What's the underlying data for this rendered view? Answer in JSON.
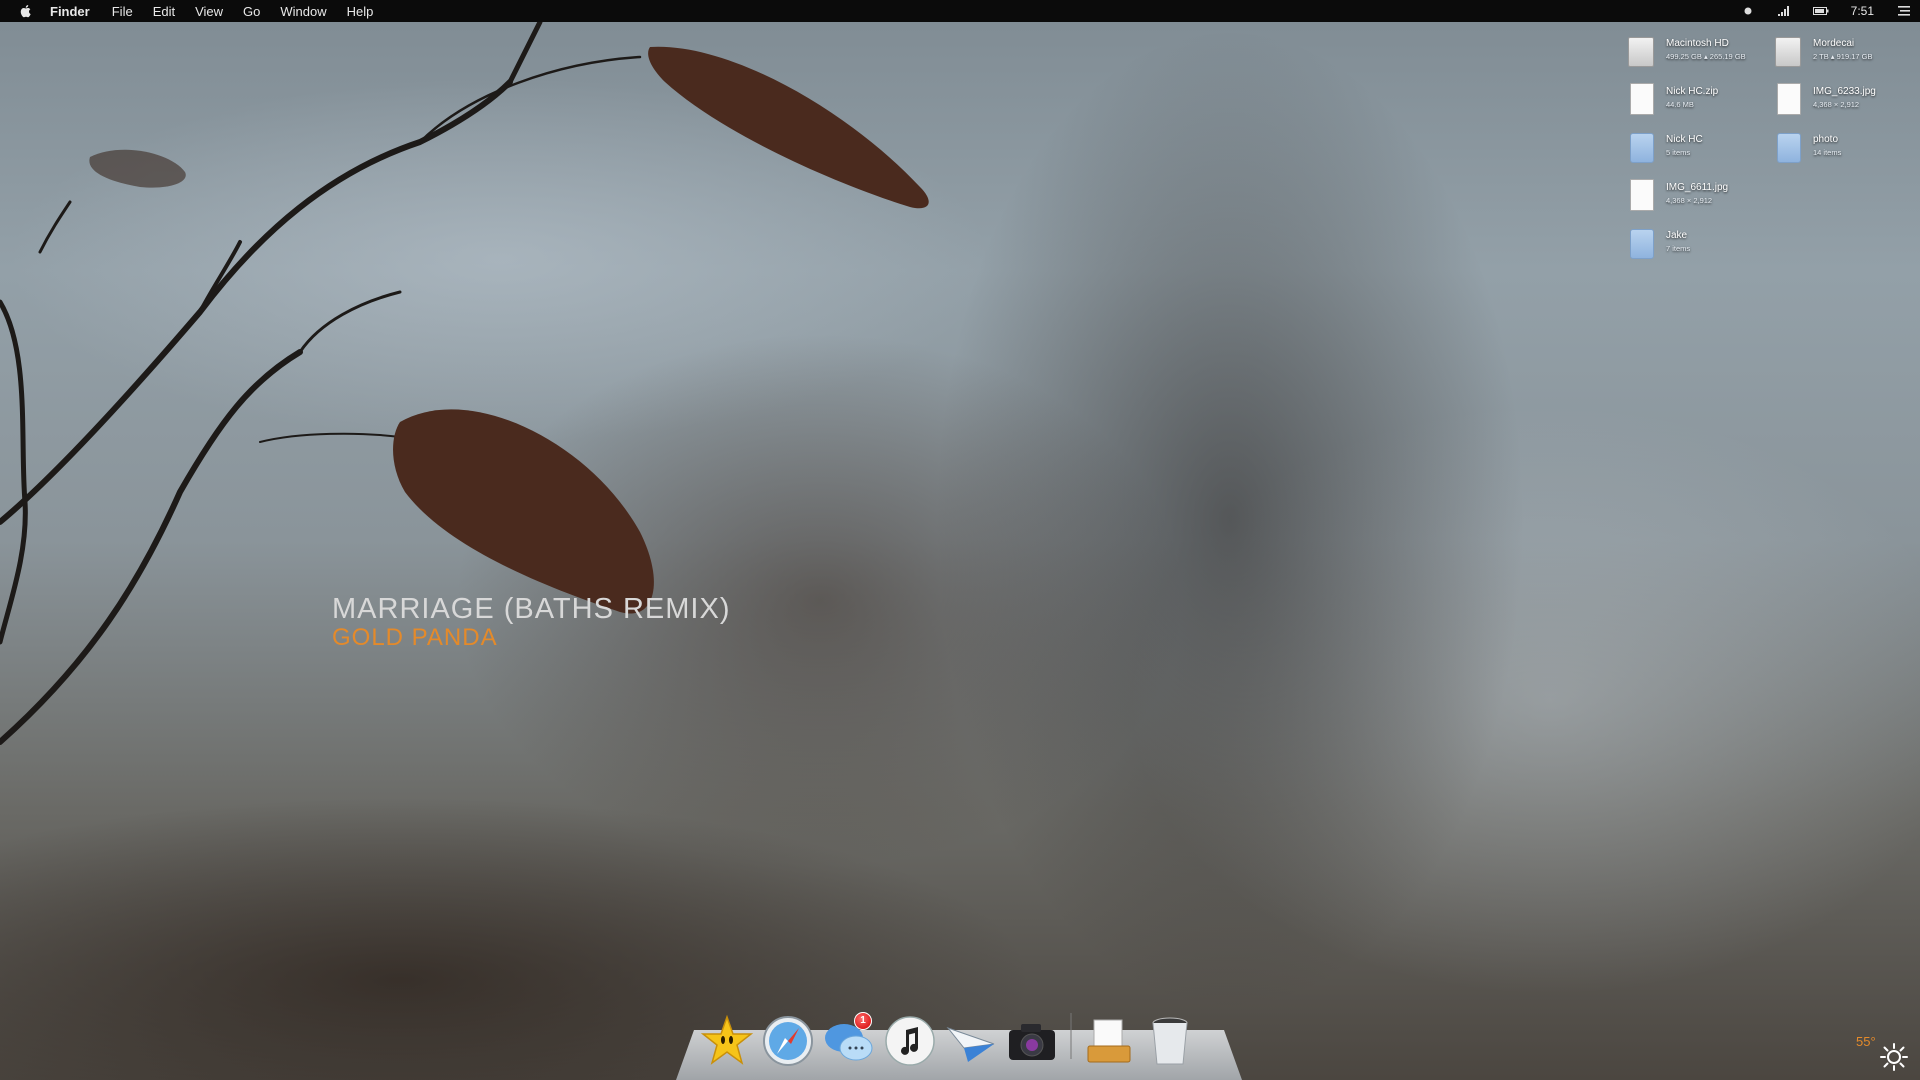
{
  "menubar": {
    "app": "Finder",
    "items": [
      "File",
      "Edit",
      "View",
      "Go",
      "Window",
      "Help"
    ],
    "clock": "7:51"
  },
  "now_playing": {
    "title": "MARRIAGE (BATHS REMIX)",
    "artist": "GOLD PANDA"
  },
  "desktop_items": [
    {
      "name": "Macintosh HD",
      "info": "499.25 GB ▴ 265.19 GB",
      "kind": "drive"
    },
    {
      "name": "Mordecai",
      "info": "2 TB ▴ 919.17 GB",
      "kind": "drive"
    },
    {
      "name": "Nick HC.zip",
      "info": "44.6 MB",
      "kind": "zip"
    },
    {
      "name": "IMG_6233.jpg",
      "info": "4,368 × 2,912",
      "kind": "jpeg"
    },
    {
      "name": "Nick HC",
      "info": "5 items",
      "kind": "folder"
    },
    {
      "name": "photo",
      "info": "14 items",
      "kind": "folder"
    },
    {
      "name": "IMG_6611.jpg",
      "info": "4,368 × 2,912",
      "kind": "jpeg"
    },
    {
      "name": "Jake",
      "info": "7 items",
      "kind": "folder"
    }
  ],
  "dock": {
    "apps": [
      "star-app",
      "safari",
      "messages",
      "itunes",
      "mail-plane",
      "camera-app",
      "inbox-tray",
      "trash"
    ],
    "messages_badge": "1"
  },
  "weather": {
    "temp": "55°"
  },
  "colors": {
    "accent": "#e48a2a",
    "title": "#d8d8d8"
  }
}
